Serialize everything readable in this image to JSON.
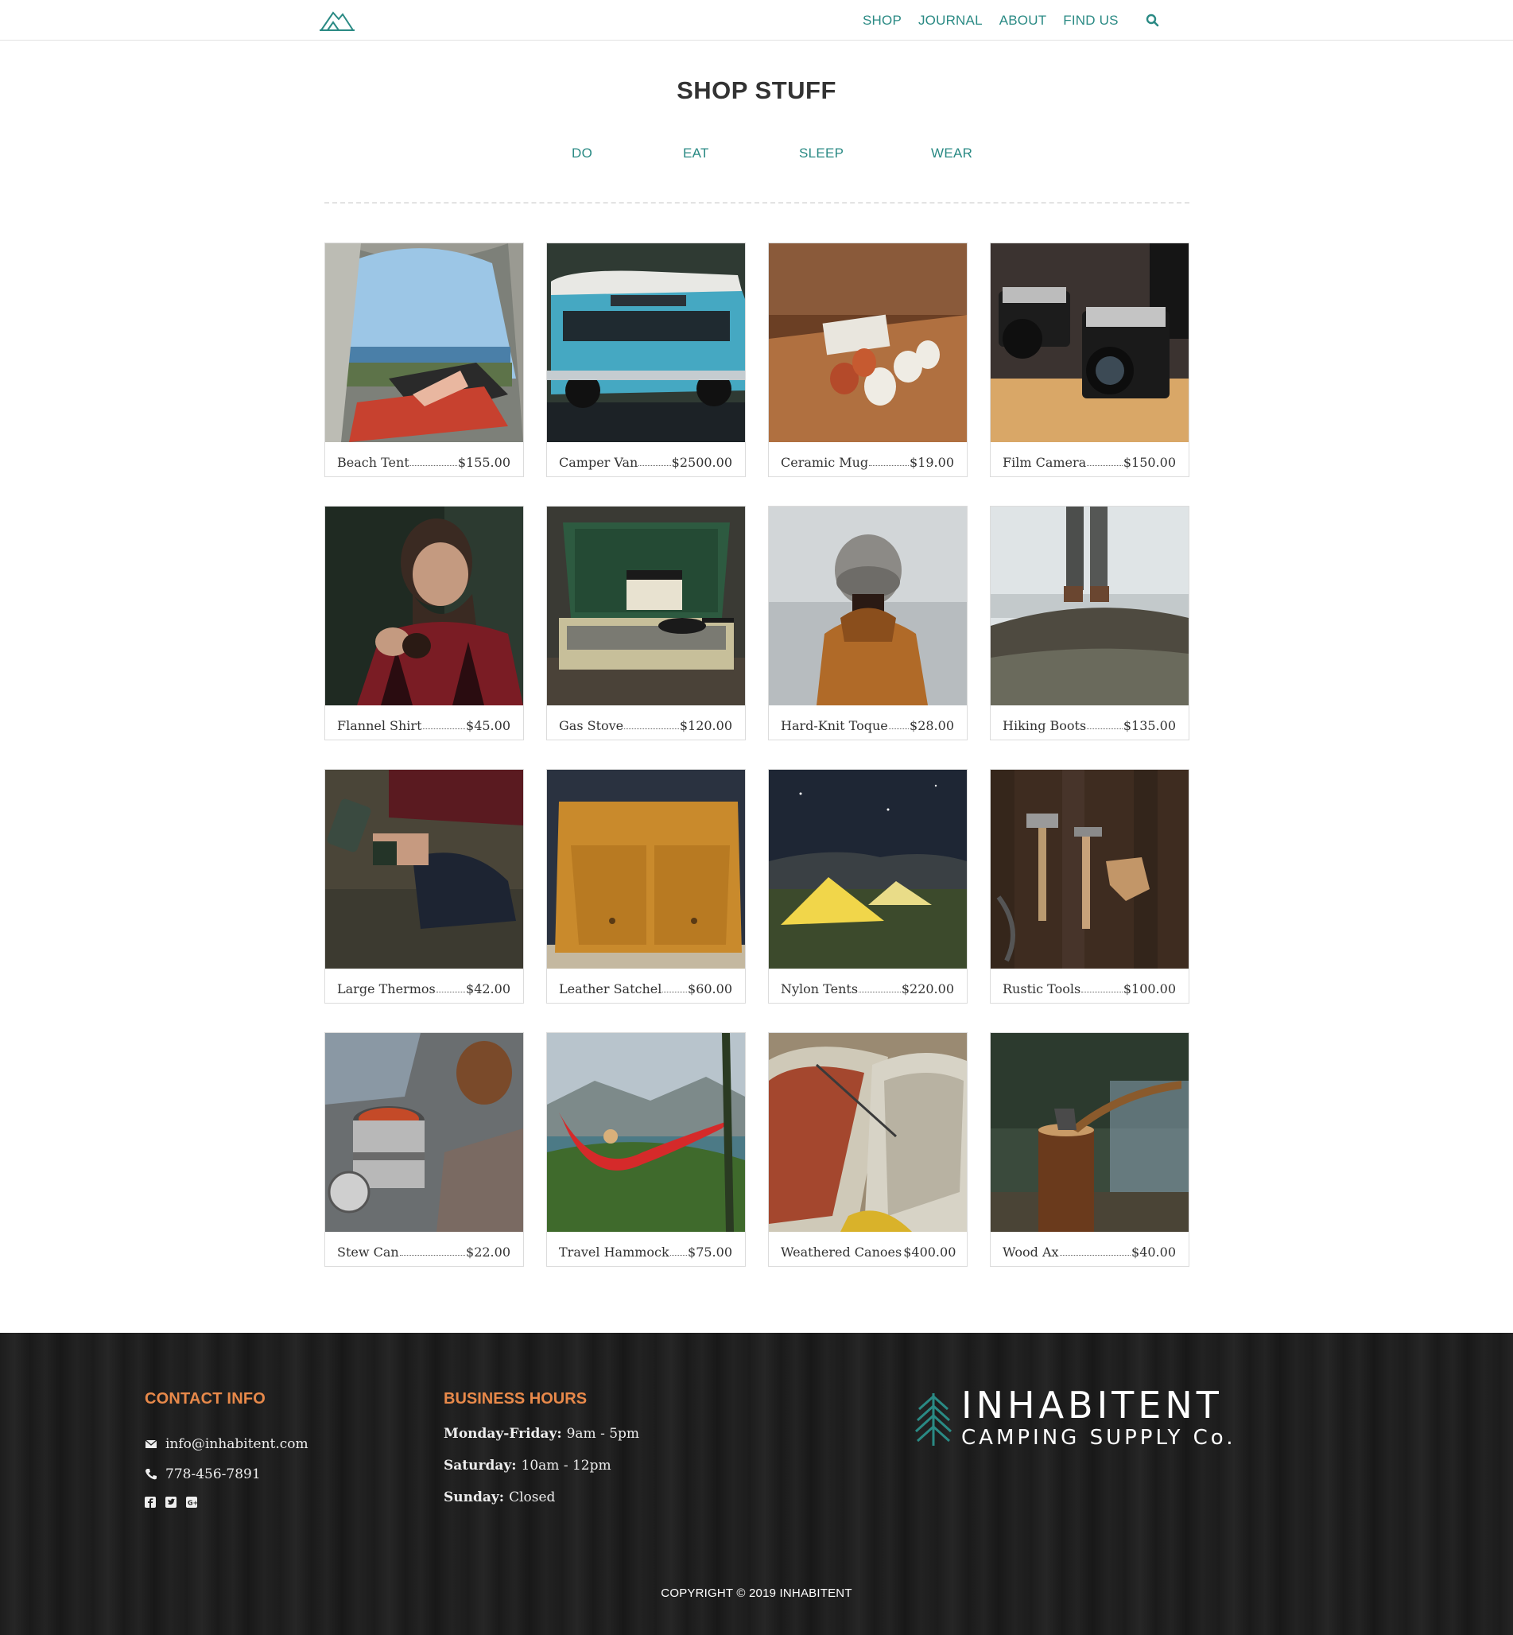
{
  "header": {
    "nav": [
      "SHOP",
      "JOURNAL",
      "ABOUT",
      "FIND US"
    ],
    "search_icon": "search-icon",
    "logo_icon": "tent-logo-icon",
    "accent_color": "#2a8a84"
  },
  "page": {
    "title": "SHOP STUFF",
    "categories": [
      "DO",
      "EAT",
      "SLEEP",
      "WEAR"
    ]
  },
  "products": [
    {
      "name": "Beach Tent",
      "price": "$155.00"
    },
    {
      "name": "Camper Van",
      "price": "$2500.00"
    },
    {
      "name": "Ceramic Mug",
      "price": "$19.00"
    },
    {
      "name": "Film Camera",
      "price": "$150.00"
    },
    {
      "name": "Flannel Shirt",
      "price": "$45.00"
    },
    {
      "name": "Gas Stove",
      "price": "$120.00"
    },
    {
      "name": "Hard-Knit Toque",
      "price": "$28.00"
    },
    {
      "name": "Hiking Boots",
      "price": "$135.00"
    },
    {
      "name": "Large Thermos",
      "price": "$42.00"
    },
    {
      "name": "Leather Satchel",
      "price": "$60.00"
    },
    {
      "name": "Nylon Tents",
      "price": "$220.00"
    },
    {
      "name": "Rustic Tools",
      "price": "$100.00"
    },
    {
      "name": "Stew Can",
      "price": "$22.00"
    },
    {
      "name": "Travel Hammock",
      "price": "$75.00"
    },
    {
      "name": "Weathered Canoes",
      "price": "$400.00"
    },
    {
      "name": "Wood Ax",
      "price": "$40.00"
    }
  ],
  "footer": {
    "contact_heading": "CONTACT INFO",
    "email": "info@inhabitent.com",
    "phone": "778-456-7891",
    "social_icons": [
      "facebook-icon",
      "twitter-icon",
      "google-plus-icon"
    ],
    "hours_heading": "BUSINESS HOURS",
    "hours": [
      {
        "day": "Monday-Friday:",
        "time": "9am - 5pm"
      },
      {
        "day": "Saturday:",
        "time": "10am - 12pm"
      },
      {
        "day": "Sunday:",
        "time": "Closed"
      }
    ],
    "brand_name": "INHABITENT",
    "brand_sub": "CAMPING SUPPLY Co.",
    "copyright": "COPYRIGHT © 2019 INHABITENT",
    "heading_color": "#e8894a"
  }
}
